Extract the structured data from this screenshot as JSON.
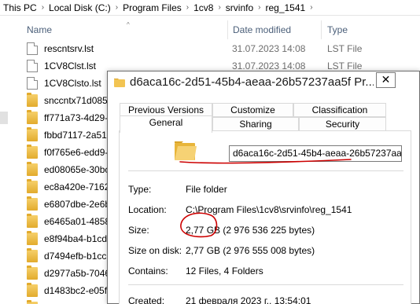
{
  "breadcrumb": {
    "items": [
      "This PC",
      "Local Disk (C:)",
      "Program Files",
      "1cv8",
      "srvinfo",
      "reg_1541"
    ],
    "separator": "›"
  },
  "columns": {
    "name": "Name",
    "date": "Date modified",
    "type": "Type"
  },
  "files": [
    {
      "name": "rescntsrv.lst",
      "date": "31.07.2023 14:08",
      "type": "LST File",
      "icon": "file-icon"
    },
    {
      "name": "1CV8Clst.lst",
      "date": "31.07.2023 14:08",
      "type": "LST File",
      "icon": "file-icon"
    },
    {
      "name": "1CV8Clsto.lst",
      "date": "",
      "type": "",
      "icon": "file-icon"
    },
    {
      "name": "snccntx71d085",
      "date": "",
      "type": "",
      "icon": "folder-icon"
    },
    {
      "name": "ff771a73-4d29-",
      "date": "",
      "type": "",
      "icon": "folder-icon"
    },
    {
      "name": "fbbd7117-2a51",
      "date": "",
      "type": "",
      "icon": "folder-icon"
    },
    {
      "name": "f0f765e6-edd9-",
      "date": "",
      "type": "",
      "icon": "folder-icon"
    },
    {
      "name": "ed08065e-30bc",
      "date": "",
      "type": "",
      "icon": "folder-icon"
    },
    {
      "name": "ec8a420e-7162-",
      "date": "",
      "type": "",
      "icon": "folder-icon"
    },
    {
      "name": "e6807dbe-2e6b",
      "date": "",
      "type": "",
      "icon": "folder-icon"
    },
    {
      "name": "e6465a01-4858-",
      "date": "",
      "type": "",
      "icon": "folder-icon"
    },
    {
      "name": "e8f94ba4-b1cd",
      "date": "",
      "type": "",
      "icon": "folder-icon"
    },
    {
      "name": "d7494efb-b1cc",
      "date": "",
      "type": "",
      "icon": "folder-icon"
    },
    {
      "name": "d2977a5b-7046",
      "date": "",
      "type": "",
      "icon": "folder-icon"
    },
    {
      "name": "d1483bc2-e05f-",
      "date": "",
      "type": "",
      "icon": "folder-icon"
    },
    {
      "name": "d99c4949-cd73",
      "date": "",
      "type": "",
      "icon": "folder-icon"
    }
  ],
  "dialog": {
    "title": "d6aca16c-2d51-45b4-aeaa-26b57237aa5f Pr...",
    "close_label": "✕",
    "tabs": {
      "previous_versions": "Previous Versions",
      "customize": "Customize",
      "classification": "Classification",
      "general": "General",
      "sharing": "Sharing",
      "security": "Security"
    },
    "folder_name": "d6aca16c-2d51-45b4-aeaa-26b57237aa5f",
    "properties": {
      "type_label": "Type:",
      "type_value": "File folder",
      "location_label": "Location:",
      "location_value": "C:\\Program Files\\1cv8\\srvinfo\\reg_1541",
      "size_label": "Size:",
      "size_value": "2,77 GB (2 976 536 225 bytes)",
      "size_on_disk_label": "Size on disk:",
      "size_on_disk_value": "2,77 GB (2 976 555 008 bytes)",
      "contains_label": "Contains:",
      "contains_value": "12 Files, 4 Folders",
      "created_label": "Created:",
      "created_value": "21 февраля 2023 г., 13:54:01"
    }
  },
  "colors": {
    "annotation_red": "#cc0000",
    "folder_yellow": "#e2ab2d",
    "header_text": "#4c607a"
  }
}
